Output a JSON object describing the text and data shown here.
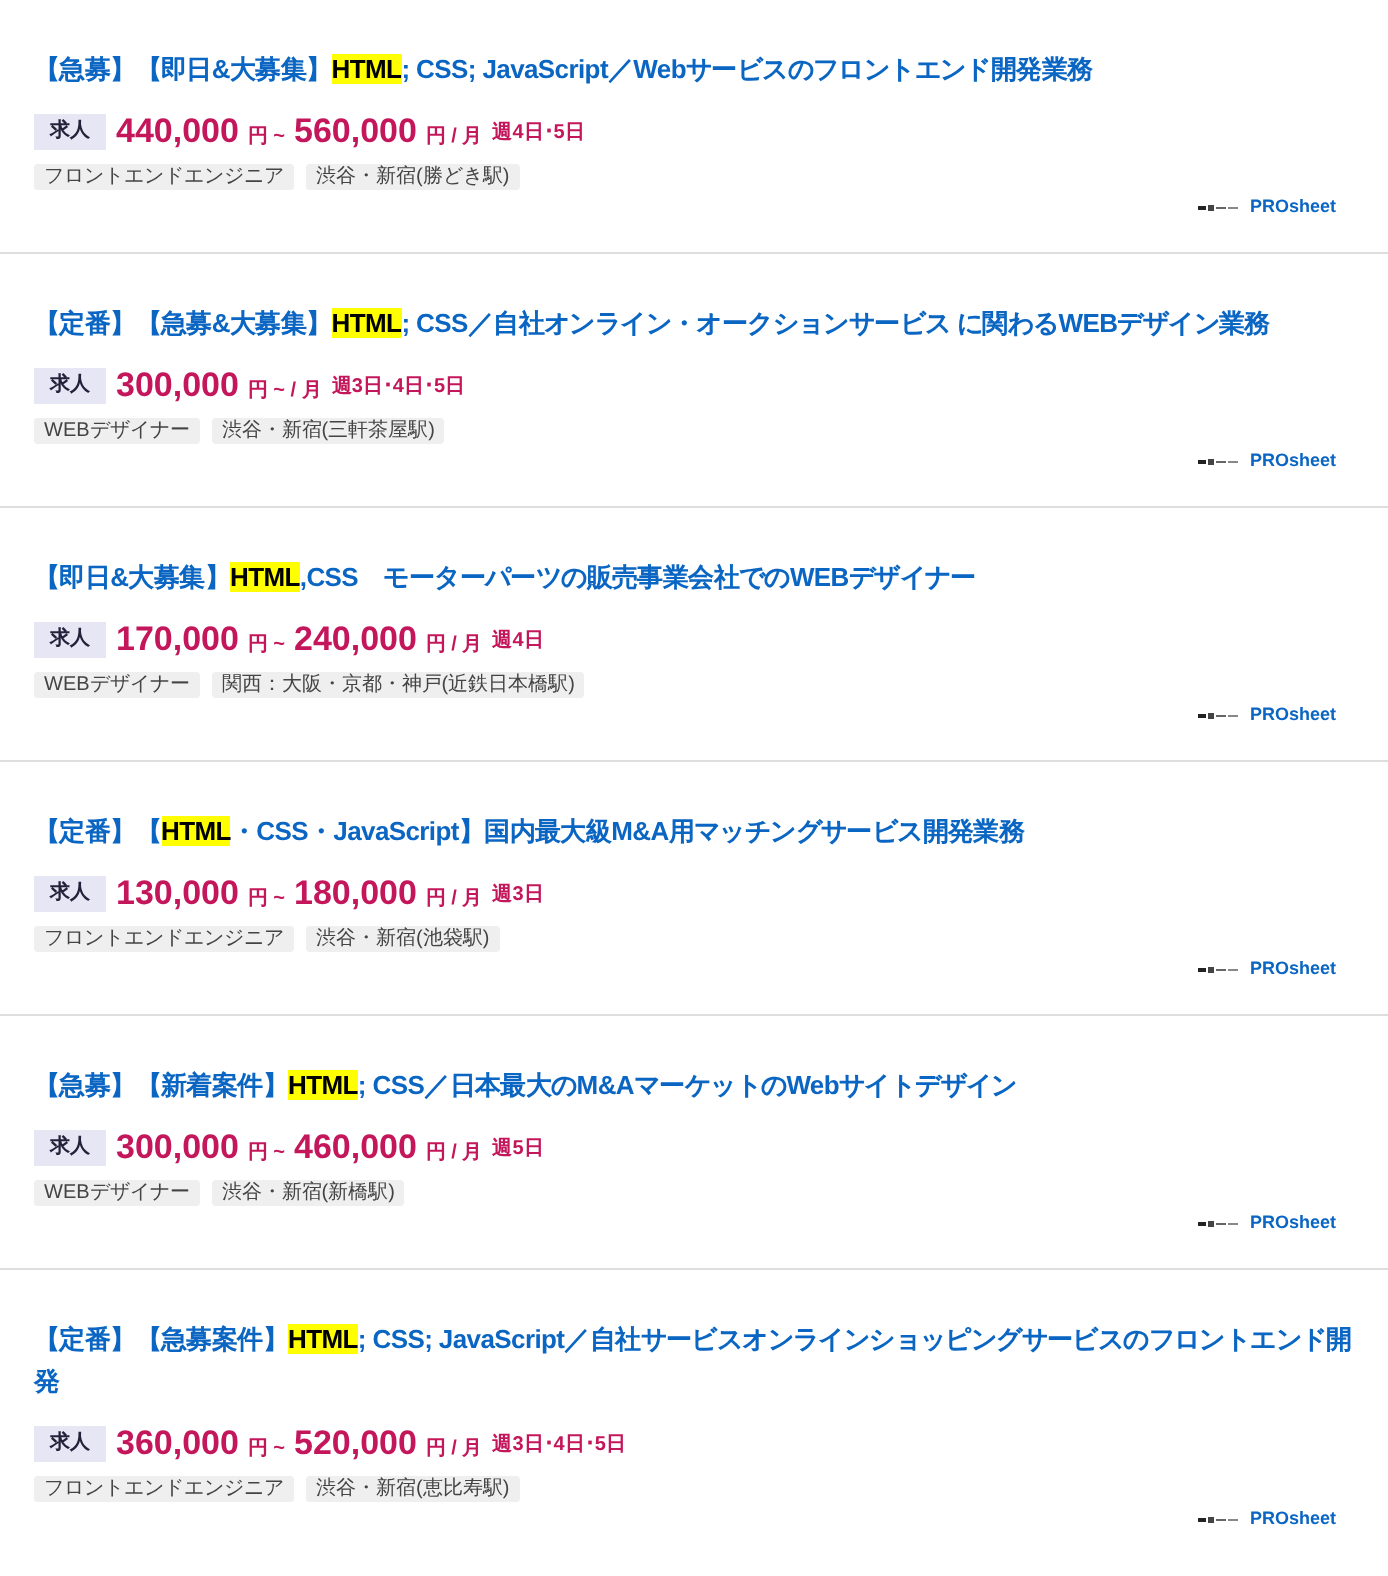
{
  "jobs": [
    {
      "title": [
        {
          "text": "【急募】【即日&大募集】",
          "highlighted": false
        },
        {
          "text": "HTML",
          "highlighted": true
        },
        {
          "text": "; CSS; JavaScript／Webサービスのフロントエンド開発業務",
          "highlighted": false
        }
      ],
      "type_label": "求人",
      "salary": [
        {
          "text": "440,000",
          "kind": "amount"
        },
        {
          "text": "円 ~",
          "kind": "unit"
        },
        {
          "text": "560,000",
          "kind": "amount"
        },
        {
          "text": "円 / 月",
          "kind": "unit"
        }
      ],
      "work_days": "週4日･5日",
      "category": "フロントエンドエンジニア",
      "location": "渋谷・新宿(勝どき駅)",
      "source": "PROsheet"
    },
    {
      "title": [
        {
          "text": "【定番】【急募&大募集】",
          "highlighted": false
        },
        {
          "text": "HTML",
          "highlighted": true
        },
        {
          "text": "; CSS／自社オンライン・オークションサービス に関わるWEBデザイン業務",
          "highlighted": false
        }
      ],
      "type_label": "求人",
      "salary": [
        {
          "text": "300,000",
          "kind": "amount"
        },
        {
          "text": "円 ~ / 月",
          "kind": "unit"
        }
      ],
      "work_days": "週3日･4日･5日",
      "category": "WEBデザイナー",
      "location": "渋谷・新宿(三軒茶屋駅)",
      "source": "PROsheet"
    },
    {
      "title": [
        {
          "text": "【即日&大募集】",
          "highlighted": false
        },
        {
          "text": "HTML",
          "highlighted": true
        },
        {
          "text": ",CSS　モーターパーツの販売事業会社でのWEBデザイナー",
          "highlighted": false
        }
      ],
      "type_label": "求人",
      "salary": [
        {
          "text": "170,000",
          "kind": "amount"
        },
        {
          "text": "円 ~",
          "kind": "unit"
        },
        {
          "text": "240,000",
          "kind": "amount"
        },
        {
          "text": "円 / 月",
          "kind": "unit"
        }
      ],
      "work_days": "週4日",
      "category": "WEBデザイナー",
      "location": "関西：大阪・京都・神戸(近鉄日本橋駅)",
      "source": "PROsheet"
    },
    {
      "title": [
        {
          "text": "【定番】【",
          "highlighted": false
        },
        {
          "text": "HTML",
          "highlighted": true
        },
        {
          "text": "・CSS・JavaScript】国内最大級M&A用マッチングサービス開発業務",
          "highlighted": false
        }
      ],
      "type_label": "求人",
      "salary": [
        {
          "text": "130,000",
          "kind": "amount"
        },
        {
          "text": "円 ~",
          "kind": "unit"
        },
        {
          "text": "180,000",
          "kind": "amount"
        },
        {
          "text": "円 / 月",
          "kind": "unit"
        }
      ],
      "work_days": "週3日",
      "category": "フロントエンドエンジニア",
      "location": "渋谷・新宿(池袋駅)",
      "source": "PROsheet"
    },
    {
      "title": [
        {
          "text": "【急募】【新着案件】",
          "highlighted": false
        },
        {
          "text": "HTML",
          "highlighted": true
        },
        {
          "text": "; CSS／日本最大のM&AマーケットのWebサイトデザイン",
          "highlighted": false
        }
      ],
      "type_label": "求人",
      "salary": [
        {
          "text": "300,000",
          "kind": "amount"
        },
        {
          "text": "円 ~",
          "kind": "unit"
        },
        {
          "text": "460,000",
          "kind": "amount"
        },
        {
          "text": "円 / 月",
          "kind": "unit"
        }
      ],
      "work_days": "週5日",
      "category": "WEBデザイナー",
      "location": "渋谷・新宿(新橋駅)",
      "source": "PROsheet"
    },
    {
      "title": [
        {
          "text": "【定番】【急募案件】",
          "highlighted": false
        },
        {
          "text": "HTML",
          "highlighted": true
        },
        {
          "text": "; CSS; JavaScript／自社サービスオンラインショッピングサービスのフロントエンド開発",
          "highlighted": false
        }
      ],
      "type_label": "求人",
      "salary": [
        {
          "text": "360,000",
          "kind": "amount"
        },
        {
          "text": "円 ~",
          "kind": "unit"
        },
        {
          "text": "520,000",
          "kind": "amount"
        },
        {
          "text": "円 / 月",
          "kind": "unit"
        }
      ],
      "work_days": "週3日･4日･5日",
      "category": "フロントエンドエンジニア",
      "location": "渋谷・新宿(恵比寿駅)",
      "source": "PROsheet"
    }
  ]
}
